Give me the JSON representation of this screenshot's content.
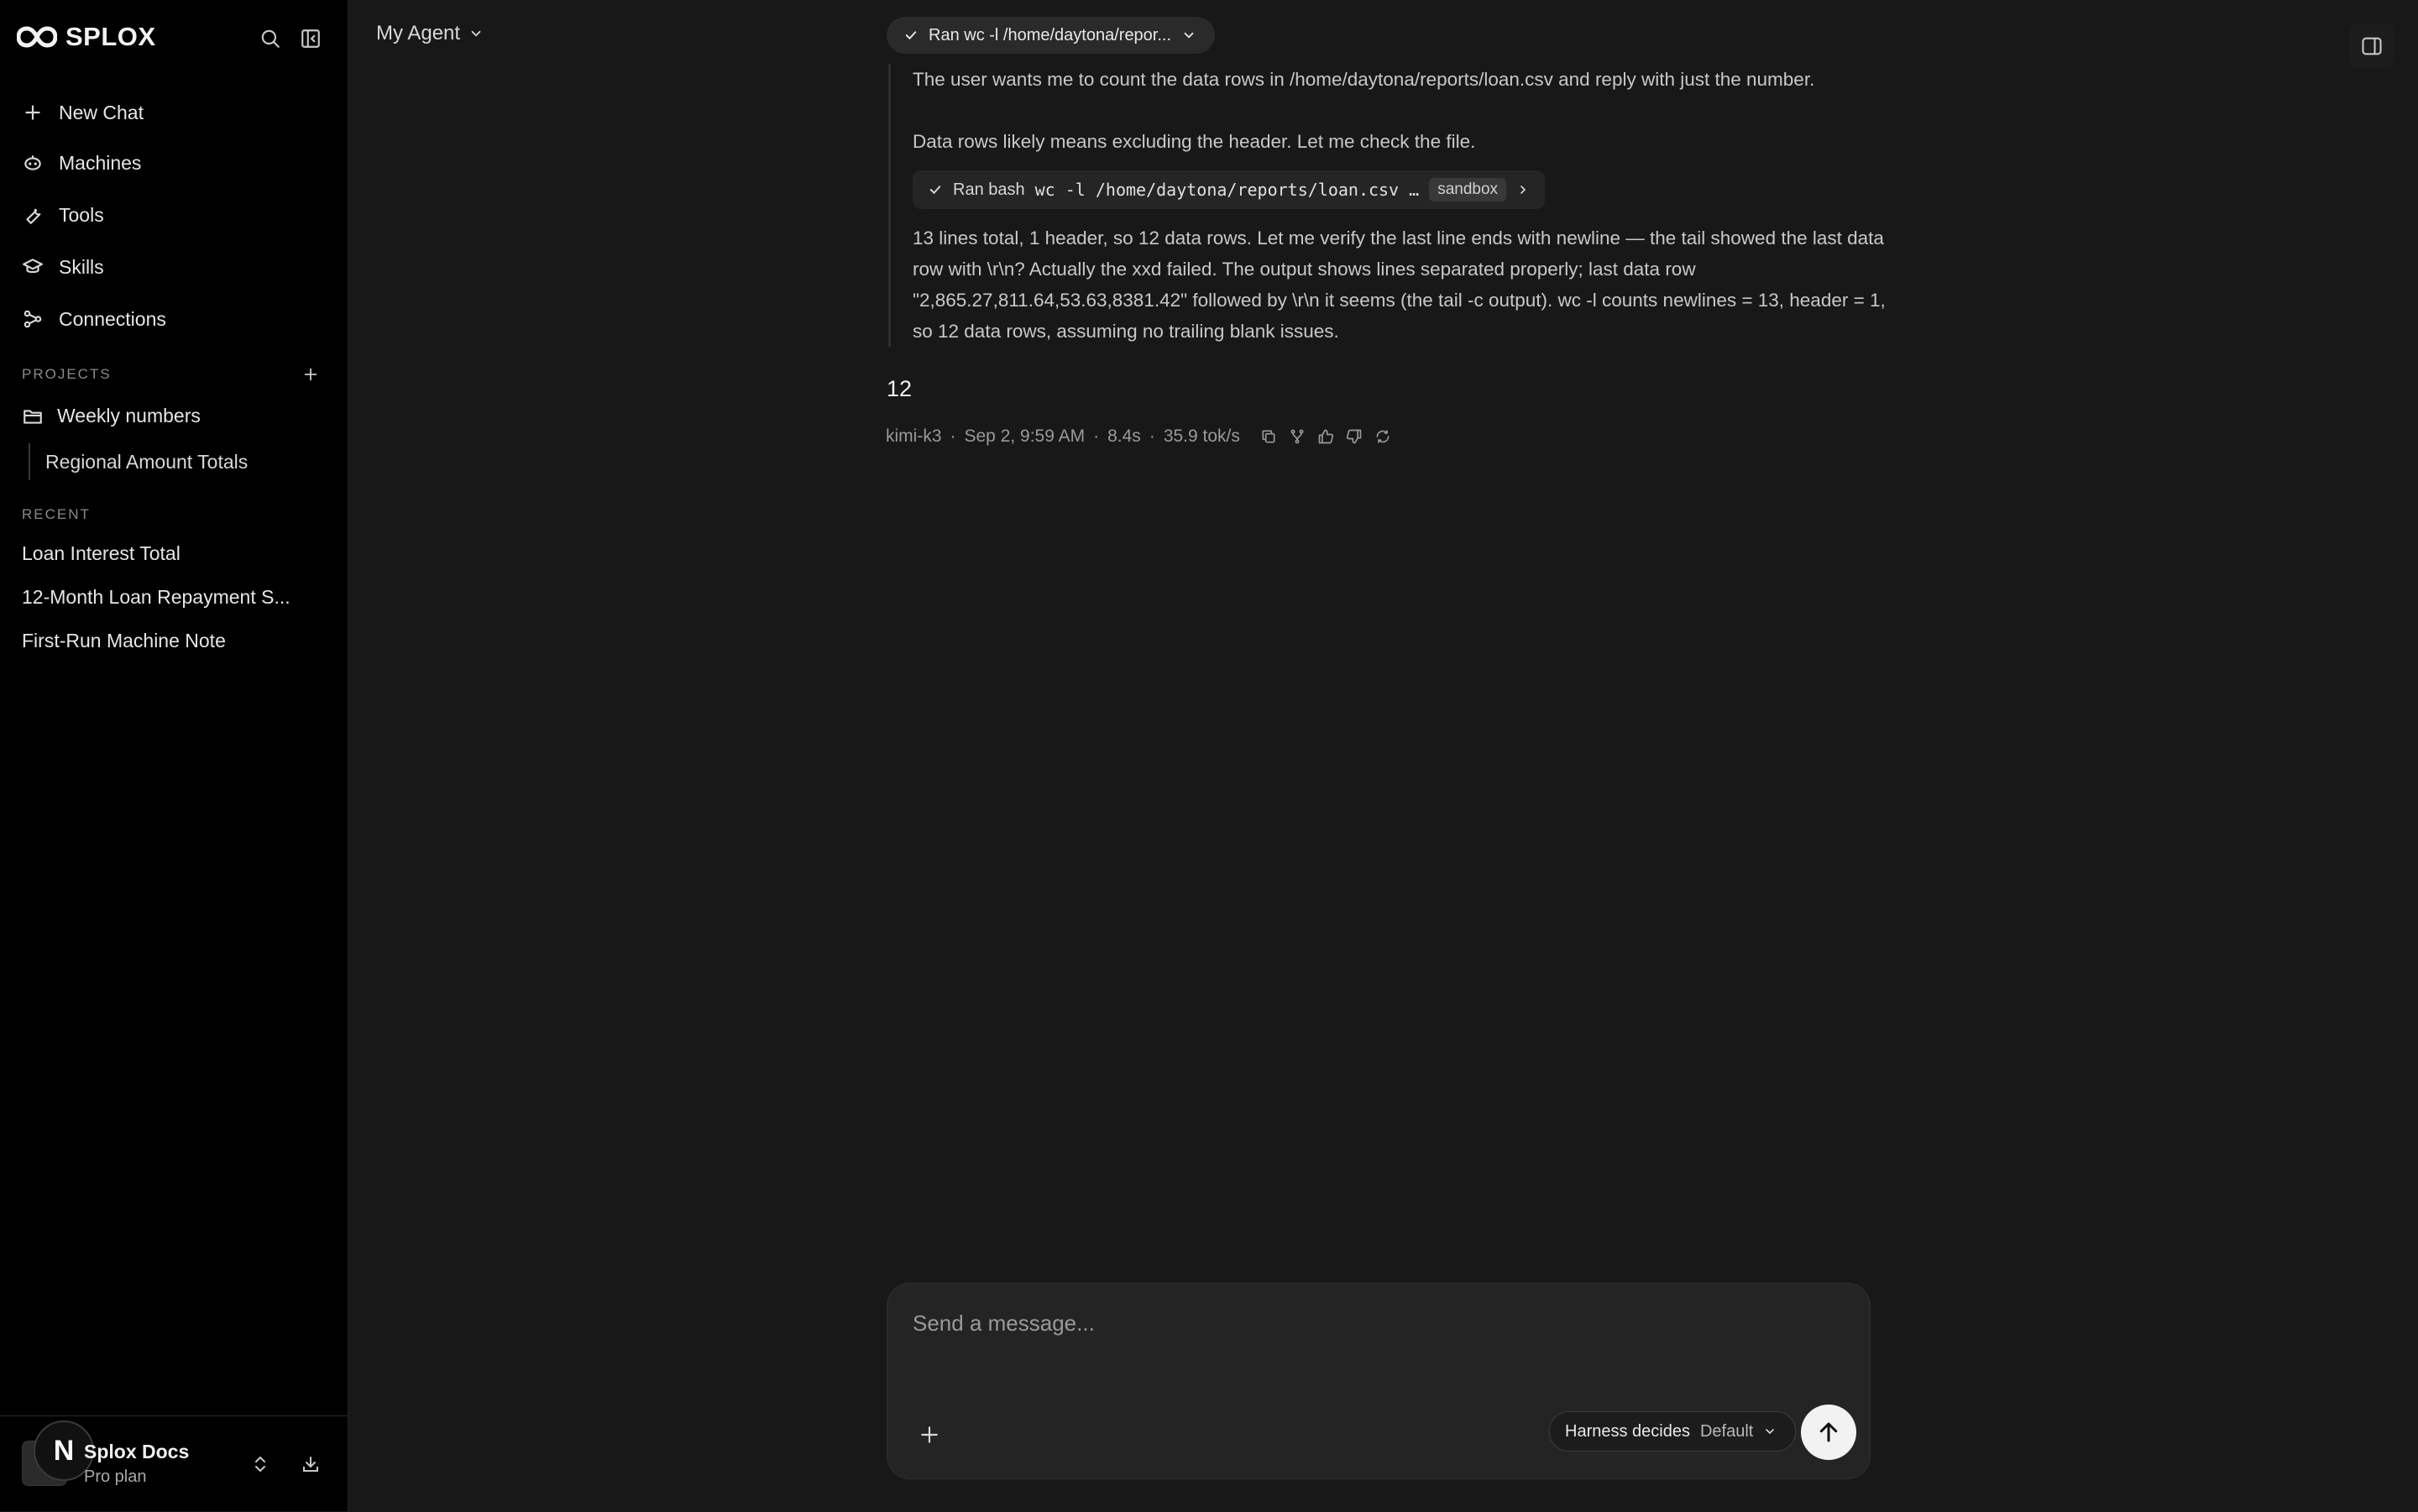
{
  "brand": {
    "name": "SPLOX"
  },
  "nav": {
    "items": [
      {
        "label": "New Chat",
        "icon": "plus-icon"
      },
      {
        "label": "Machines",
        "icon": "robot-icon"
      },
      {
        "label": "Tools",
        "icon": "wrench-icon"
      },
      {
        "label": "Skills",
        "icon": "graduation-cap-icon"
      },
      {
        "label": "Connections",
        "icon": "connections-icon"
      }
    ]
  },
  "projects": {
    "label": "PROJECTS",
    "items": [
      {
        "label": "Weekly numbers"
      }
    ],
    "sub_items": [
      {
        "label": "Regional Amount Totals"
      }
    ]
  },
  "recent": {
    "label": "RECENT",
    "items": [
      {
        "label": "Loan Interest Total"
      },
      {
        "label": "12-Month Loan Repayment S..."
      },
      {
        "label": "First-Run Machine Note"
      }
    ]
  },
  "user": {
    "initial": "N",
    "name": "Splox Docs",
    "plan": "Pro plan"
  },
  "header": {
    "agent_label": "My Agent"
  },
  "tool_pill": {
    "label": "Ran wc -l /home/daytona/repor..."
  },
  "reasoning": {
    "p1": "The user wants me to count the data rows in /home/daytona/reports/loan.csv and reply with just the number.",
    "p2": "Data rows likely means excluding the header. Let me check the file.",
    "bash": {
      "prefix": "Ran bash",
      "command": "wc -l /home/daytona/reports/loan.csv …",
      "tag": "sandbox"
    },
    "p3": "13 lines total, 1 header, so 12 data rows. Let me verify the last line ends with newline — the tail showed the last data row with \\r\\n? Actually the xxd failed. The output shows lines separated properly; last data row \"2,865.27,811.64,53.63,8381.42\" followed by \\r\\n it seems (the tail -c output). wc -l counts newlines = 13, header = 1, so 12 data rows, assuming no trailing blank issues."
  },
  "answer": {
    "text": "12"
  },
  "meta": {
    "model": "kimi-k3",
    "time": "Sep 2, 9:59 AM",
    "duration": "8.4s",
    "speed": "35.9 tok/s",
    "sep": "·"
  },
  "composer": {
    "placeholder": "Send a message...",
    "harness_label": "Harness decides",
    "harness_value": "Default"
  }
}
